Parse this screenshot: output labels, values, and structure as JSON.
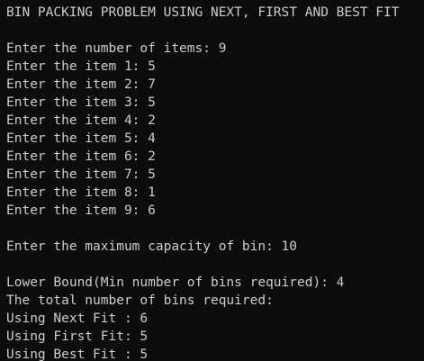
{
  "console": {
    "title": "BIN PACKING PROBLEM USING NEXT, FIRST AND BEST FIT",
    "num_items_prompt": "Enter the number of items: 9",
    "items": [
      "Enter the item 1: 5",
      "Enter the item 2: 7",
      "Enter the item 3: 5",
      "Enter the item 4: 2",
      "Enter the item 5: 4",
      "Enter the item 6: 2",
      "Enter the item 7: 5",
      "Enter the item 8: 1",
      "Enter the item 9: 6"
    ],
    "capacity_prompt": "Enter the maximum capacity of bin: 10",
    "lower_bound": "Lower Bound(Min number of bins required): 4",
    "total_header": "The total number of bins required:",
    "next_fit": "Using Next Fit : 6",
    "first_fit": "Using First Fit: 5",
    "best_fit": "Using Best Fit : 5"
  },
  "colors": {
    "background": "#0c0c0c",
    "text": "#cccccc"
  }
}
